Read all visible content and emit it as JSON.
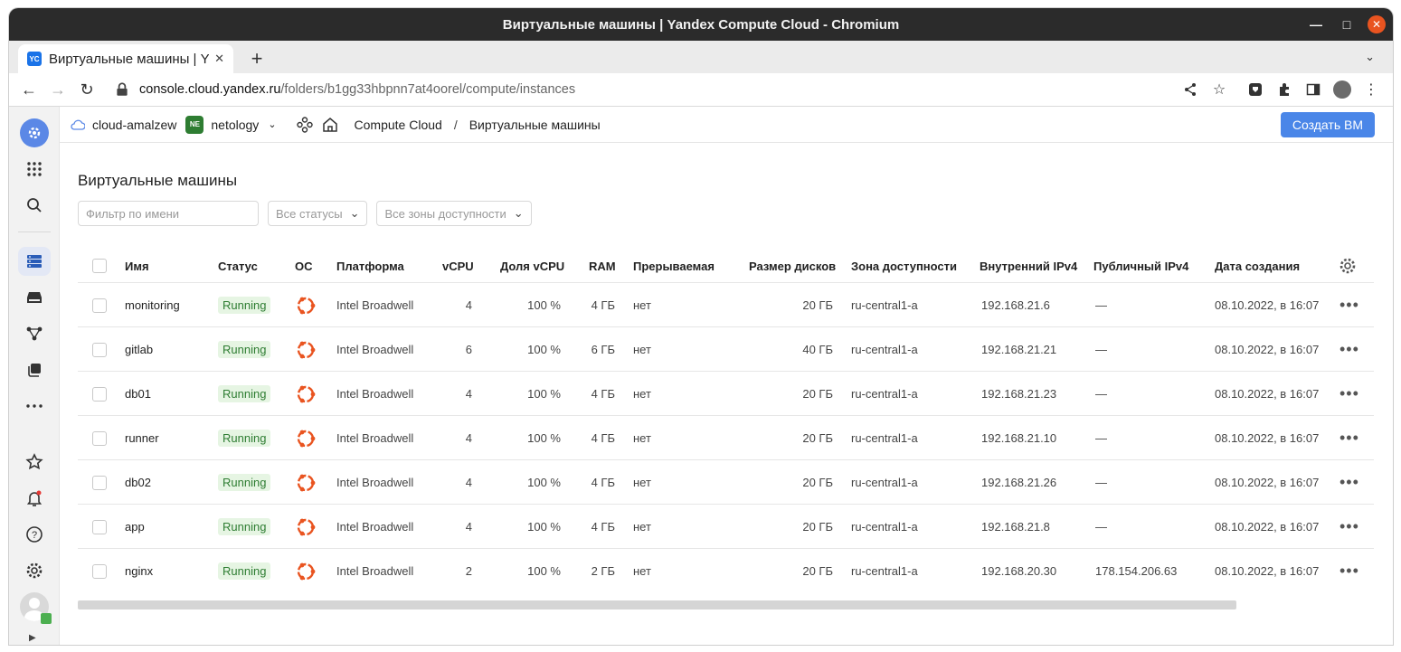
{
  "window": {
    "title": "Виртуальные машины | Yandex Compute Cloud - Chromium"
  },
  "tab": {
    "favicon": "YC",
    "title": "Виртуальные машины | Ya"
  },
  "address": {
    "host": "console.cloud.yandex.ru",
    "path": "/folders/b1gg33hbpnn7at4oorel/compute/instances"
  },
  "header": {
    "cloud": "cloud-amalzew",
    "folder_badge": "NE",
    "folder": "netology",
    "service": "Compute Cloud",
    "separator": "/",
    "current": "Виртуальные машины",
    "create_button": "Создать ВМ"
  },
  "page": {
    "title": "Виртуальные машины",
    "filter_placeholder": "Фильтр по имени",
    "status_select": "Все статусы",
    "zone_select": "Все зоны доступности"
  },
  "table": {
    "columns": [
      "Имя",
      "Статус",
      "ОС",
      "Платформа",
      "vCPU",
      "Доля vCPU",
      "RAM",
      "Прерываемая",
      "Размер дисков",
      "Зона доступности",
      "Внутренний IPv4",
      "Публичный IPv4",
      "Дата создания"
    ],
    "rows": [
      {
        "name": "monitoring",
        "status": "Running",
        "platform": "Intel Broadwell",
        "vcpu": "4",
        "share": "100 %",
        "ram": "4 ГБ",
        "preemptible": "нет",
        "disk": "20 ГБ",
        "zone": "ru-central1-a",
        "ip": "192.168.21.6",
        "public_ip": "—",
        "created": "08.10.2022, в 16:07"
      },
      {
        "name": "gitlab",
        "status": "Running",
        "platform": "Intel Broadwell",
        "vcpu": "6",
        "share": "100 %",
        "ram": "6 ГБ",
        "preemptible": "нет",
        "disk": "40 ГБ",
        "zone": "ru-central1-a",
        "ip": "192.168.21.21",
        "public_ip": "—",
        "created": "08.10.2022, в 16:07"
      },
      {
        "name": "db01",
        "status": "Running",
        "platform": "Intel Broadwell",
        "vcpu": "4",
        "share": "100 %",
        "ram": "4 ГБ",
        "preemptible": "нет",
        "disk": "20 ГБ",
        "zone": "ru-central1-a",
        "ip": "192.168.21.23",
        "public_ip": "—",
        "created": "08.10.2022, в 16:07"
      },
      {
        "name": "runner",
        "status": "Running",
        "platform": "Intel Broadwell",
        "vcpu": "4",
        "share": "100 %",
        "ram": "4 ГБ",
        "preemptible": "нет",
        "disk": "20 ГБ",
        "zone": "ru-central1-a",
        "ip": "192.168.21.10",
        "public_ip": "—",
        "created": "08.10.2022, в 16:07"
      },
      {
        "name": "db02",
        "status": "Running",
        "platform": "Intel Broadwell",
        "vcpu": "4",
        "share": "100 %",
        "ram": "4 ГБ",
        "preemptible": "нет",
        "disk": "20 ГБ",
        "zone": "ru-central1-a",
        "ip": "192.168.21.26",
        "public_ip": "—",
        "created": "08.10.2022, в 16:07"
      },
      {
        "name": "app",
        "status": "Running",
        "platform": "Intel Broadwell",
        "vcpu": "4",
        "share": "100 %",
        "ram": "4 ГБ",
        "preemptible": "нет",
        "disk": "20 ГБ",
        "zone": "ru-central1-a",
        "ip": "192.168.21.8",
        "public_ip": "—",
        "created": "08.10.2022, в 16:07"
      },
      {
        "name": "nginx",
        "status": "Running",
        "platform": "Intel Broadwell",
        "vcpu": "2",
        "share": "100 %",
        "ram": "2 ГБ",
        "preemptible": "нет",
        "disk": "20 ГБ",
        "zone": "ru-central1-a",
        "ip": "192.168.20.30",
        "public_ip": "178.154.206.63",
        "created": "08.10.2022, в 16:07"
      }
    ]
  },
  "colors": {
    "accent": "#4a86e8",
    "status_bg": "#e6f5e3",
    "status_text": "#2e7d32",
    "os_icon": "#e95420"
  }
}
